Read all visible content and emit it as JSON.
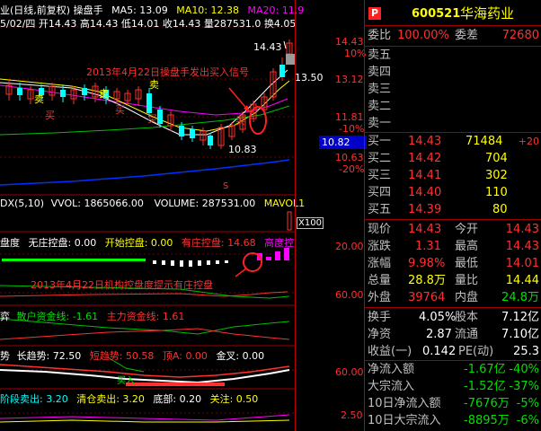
{
  "main_panel": {
    "title": "业(日线,前复权) 操盘手",
    "ma5": "MA5: 13.09",
    "ma10": "MA10: 12.38",
    "ma20": "MA20: 11.9",
    "info_line": "5/02/四 开14.43 高14.43 低14.01 收14.43 量287531.0 换4.05",
    "annotation": "2013年4月22日操盘手发出买入信号",
    "price_high_label": "14.43",
    "price_low_label": "10.83",
    "price_mid_label": "13.50",
    "buy_mark": "买",
    "sell_mark": "卖",
    "s_mark": "S"
  },
  "volume_panel": {
    "title": "DX(5,10)",
    "vvol": "VVOL: 1865066.00",
    "volume": "VOLUME: 287531.00",
    "mavol": "MAVOL1",
    "scale": "X100"
  },
  "control_panel": {
    "title": "盘度",
    "no_control": "无庄控盘: 0.00",
    "start_control": "开始控盘: 0.00",
    "has_control": "有庄控盘: 14.68",
    "high_control": "高度控",
    "annotation": "2013年4月22日机构控盘度提示有庄控盘"
  },
  "fund_panel": {
    "title": "弈",
    "retail": "散户资金线: -1.61",
    "main": "主力资金线: 1.61"
  },
  "trend_panel": {
    "title": "势",
    "long": "长趋势: 72.50",
    "short": "短趋势: 50.58",
    "top_a": "顶A: 0.00",
    "gold": "金叉: 0.00",
    "buy_mark": "买入"
  },
  "stage_panel": {
    "stage_sell": "阶段卖出: 3.20",
    "clear": "清仓卖出: 3.20",
    "bottom": "底部: 0.20",
    "focus": "关注: 0.50"
  },
  "axis": {
    "p1": "14.43",
    "p1b": "10%",
    "p2": "13.12",
    "p3": "11.81",
    "p3b": "-10%",
    "cur": "10.82",
    "p4": "10.63",
    "p4b": "-20%",
    "c1": "20.00",
    "c2": "60.00",
    "t1": "60.00",
    "s1": "2.50"
  },
  "quote": {
    "badge": "P",
    "code": "600521",
    "name": "华海药业",
    "wb_label": "委比",
    "wb_value": "100.00%",
    "wc_label": "委差",
    "wc_value": "72680",
    "sells": [
      "卖五",
      "卖四",
      "卖三",
      "卖二",
      "卖一"
    ],
    "buys": [
      {
        "label": "买一",
        "price": "14.43",
        "vol": "71484",
        "chg": "+20"
      },
      {
        "label": "买二",
        "price": "14.42",
        "vol": "704",
        "chg": ""
      },
      {
        "label": "买三",
        "price": "14.41",
        "vol": "302",
        "chg": ""
      },
      {
        "label": "买四",
        "price": "14.40",
        "vol": "110",
        "chg": ""
      },
      {
        "label": "买五",
        "price": "14.39",
        "vol": "80",
        "chg": ""
      }
    ],
    "stats": [
      {
        "l1": "现价",
        "v1": "14.43",
        "l2": "今开",
        "v2": "14.43"
      },
      {
        "l1": "涨跌",
        "v1": "1.31",
        "l2": "最高",
        "v2": "14.43"
      },
      {
        "l1": "涨幅",
        "v1": "9.98%",
        "l2": "最低",
        "v2": "14.01"
      },
      {
        "l1": "总量",
        "v1": "28.8万",
        "l2": "量比",
        "v2": "14.44"
      },
      {
        "l1": "外盘",
        "v1": "39764",
        "l2": "内盘",
        "v2": "24.8万"
      }
    ],
    "stats2": [
      {
        "l1": "换手",
        "v1": "4.05%",
        "l2": "股本",
        "v2": "7.12亿"
      },
      {
        "l1": "净资",
        "v1": "2.87",
        "l2": "流通",
        "v2": "7.10亿"
      },
      {
        "l1": "收益(一)",
        "v1": "0.142",
        "l2": "PE(动)",
        "v2": "25.3"
      }
    ],
    "flows": [
      {
        "label": "净流入额",
        "value": "-1.67亿",
        "pct": "-40%"
      },
      {
        "label": "大宗流入",
        "value": "-1.52亿",
        "pct": "-37%"
      },
      {
        "label": "10日净流入额",
        "value": "-7676万",
        "pct": "-5%"
      },
      {
        "label": "10日大宗流入",
        "value": "-8895万",
        "pct": "-6%"
      }
    ]
  }
}
